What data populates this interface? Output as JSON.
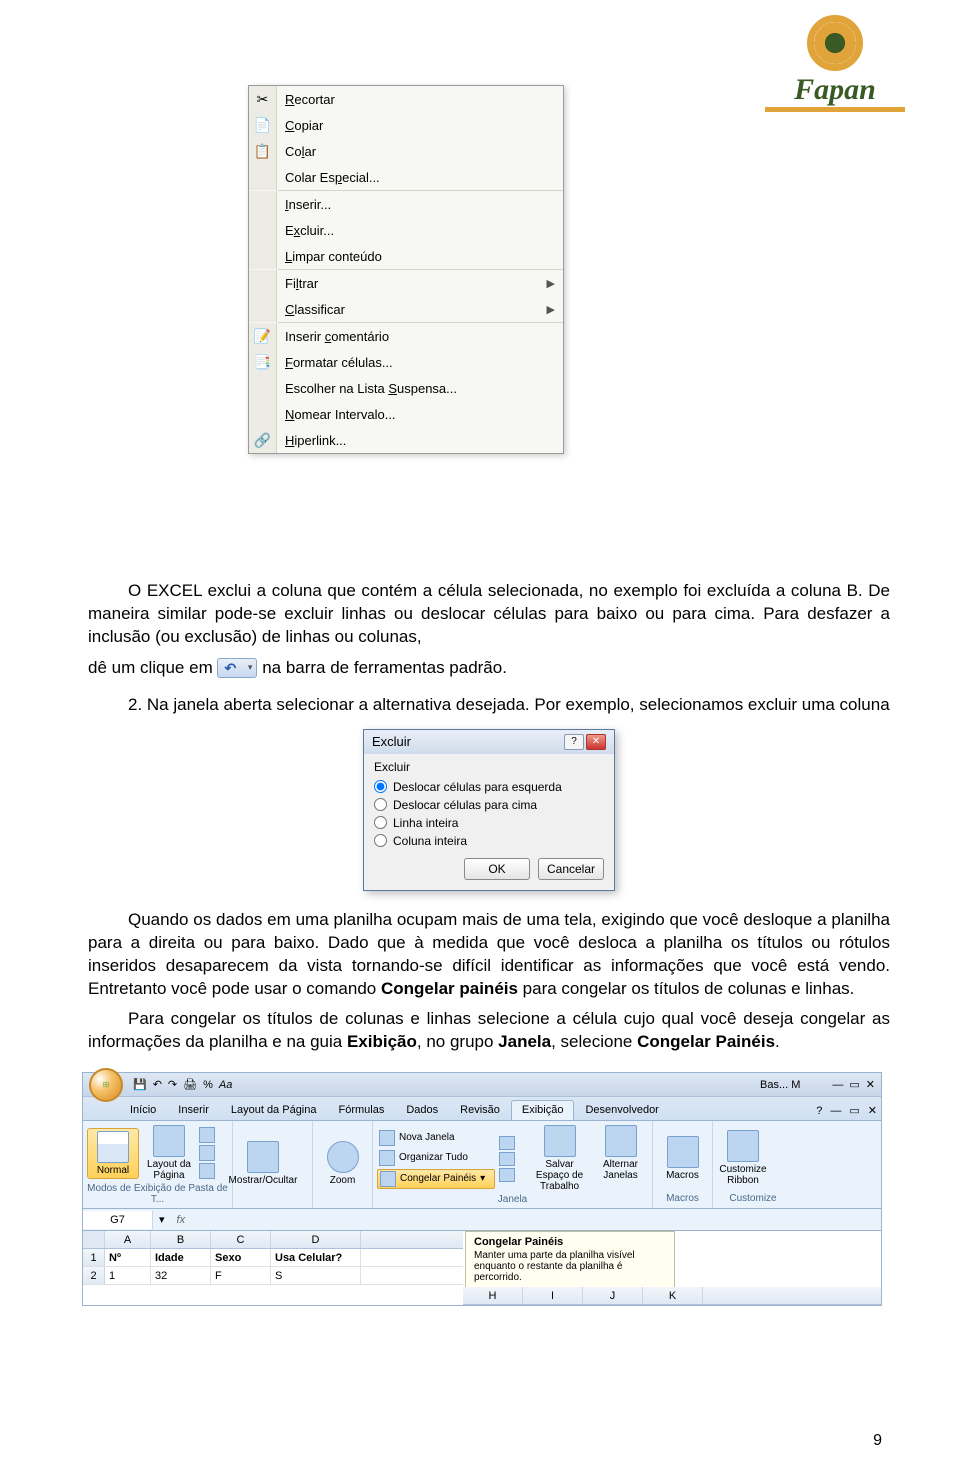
{
  "logo": {
    "text": "Fapan"
  },
  "context_menu": [
    {
      "icon": "✂",
      "label": "Recortar",
      "u": 0
    },
    {
      "icon": "📄",
      "label": "Copiar",
      "u": 0
    },
    {
      "icon": "📋",
      "label": "Colar",
      "u": 2
    },
    {
      "icon": "",
      "label": "Colar Especial...",
      "u": 8
    },
    {
      "sep": true
    },
    {
      "icon": "",
      "label": "Inserir...",
      "u": 0
    },
    {
      "icon": "",
      "label": "Excluir...",
      "u": 1
    },
    {
      "icon": "",
      "label": "Limpar conteúdo",
      "u": 0
    },
    {
      "sep": true
    },
    {
      "icon": "",
      "label": "Filtrar",
      "u": 2,
      "arrow": true
    },
    {
      "icon": "",
      "label": "Classificar",
      "u": 0,
      "arrow": true
    },
    {
      "sep": true
    },
    {
      "icon": "📝",
      "label": "Inserir comentário",
      "u": 8
    },
    {
      "icon": "📑",
      "label": "Formatar células...",
      "u": 0
    },
    {
      "icon": "",
      "label": "Escolher na Lista Suspensa...",
      "u": 18
    },
    {
      "icon": "",
      "label": "Nomear Intervalo...",
      "u": 0
    },
    {
      "icon": "🔗",
      "label": "Hiperlink...",
      "u": 0
    }
  ],
  "para1a": "O EXCEL exclui a coluna que contém a célula selecionada, no exemplo foi excluída a coluna B. De maneira similar pode-se excluir linhas ou deslocar células para baixo ou para cima. Para desfazer a inclusão (ou exclusão) de linhas ou colunas,",
  "para1b": "dê um clique em ",
  "para1c": " na barra de ferramentas padrão.",
  "para2": "2. Na janela aberta selecionar a alternativa desejada. Por exemplo, selecionamos excluir uma coluna",
  "dialog": {
    "title": "Excluir",
    "group": "Excluir",
    "opts": [
      "Deslocar células para esquerda",
      "Deslocar células para cima",
      "Linha inteira",
      "Coluna inteira"
    ],
    "ok": "OK",
    "cancel": "Cancelar"
  },
  "para3": "Quando os dados em uma planilha ocupam mais de uma tela, exigindo que você desloque a planilha para a direita ou para baixo. Dado que à medida que você desloca a planilha os títulos ou rótulos inseridos desaparecem da vista tornando-se difícil identificar as informações que você está vendo. Entretanto você pode usar o comando ",
  "para3b": "Congelar painéis",
  "para3c": " para congelar os títulos de colunas e linhas.",
  "para4": "Para congelar os títulos de colunas e linhas selecione a célula cujo qual você deseja congelar as informações da planilha e na guia ",
  "para4b": "Exibição",
  "para4c": ", no grupo ",
  "para4d": "Janela",
  "para4e": ", selecione ",
  "para4f": "Congelar Painéis",
  "para4g": ".",
  "ribbon": {
    "qat_title": "Bas... M",
    "tabs": [
      "Início",
      "Inserir",
      "Layout da Página",
      "Fórmulas",
      "Dados",
      "Revisão",
      "Exibição",
      "Desenvolvedor"
    ],
    "active_tab": 6,
    "groups": {
      "modos": {
        "normal": "Normal",
        "layout": "Layout da Página",
        "label": "Modos de Exibição de Pasta de T..."
      },
      "mostrar": {
        "btn": "Mostrar/Ocultar",
        "label": ""
      },
      "zoom": {
        "btn": "Zoom",
        "label": ""
      },
      "janela": {
        "nova": "Nova Janela",
        "org": "Organizar Tudo",
        "cong": "Congelar Painéis",
        "salvar": "Salvar Espaço de Trabalho",
        "alt": "Alternar Janelas",
        "label": "Janela"
      },
      "macros": {
        "btn": "Macros",
        "label": "Macros"
      },
      "custom": {
        "btn": "Customize Ribbon",
        "label": "Customize"
      }
    },
    "name_box": "G7",
    "tooltip": {
      "title": "Congelar Painéis",
      "body": "Manter uma parte da planilha visível enquanto o restante da planilha é percorrido."
    },
    "cols_left": [
      "A",
      "B",
      "C",
      "D"
    ],
    "cols_right": [
      "H",
      "I",
      "J",
      "K"
    ],
    "row1": [
      "Nº",
      "Idade",
      "Sexo",
      "Usa Celular?"
    ],
    "row2": [
      "1",
      "32",
      "F",
      "S"
    ]
  },
  "page_num": "9"
}
